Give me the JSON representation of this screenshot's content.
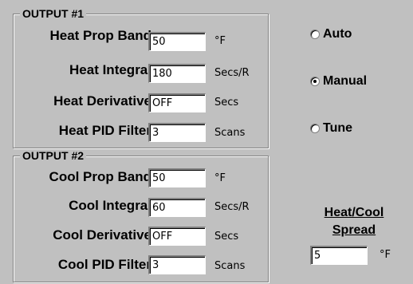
{
  "output1": {
    "title": "OUTPUT #1",
    "fields": [
      {
        "label": "Heat Prop Band",
        "value": "50",
        "unit": "°F"
      },
      {
        "label": "Heat Integral",
        "value": "180",
        "unit": "Secs/R"
      },
      {
        "label": "Heat Derivative",
        "value": "OFF",
        "unit": "Secs"
      },
      {
        "label": "Heat PID Filter",
        "value": "3",
        "unit": "Scans"
      }
    ]
  },
  "output2": {
    "title": "OUTPUT #2",
    "fields": [
      {
        "label": "Cool Prop Band",
        "value": "50",
        "unit": "°F"
      },
      {
        "label": "Cool Integral",
        "value": "60",
        "unit": "Secs/R"
      },
      {
        "label": "Cool Derivative",
        "value": "OFF",
        "unit": "Secs"
      },
      {
        "label": "Cool PID Filter",
        "value": "3",
        "unit": "Scans"
      }
    ]
  },
  "mode": {
    "options": [
      {
        "label": "Auto",
        "selected": false
      },
      {
        "label": "Manual",
        "selected": true
      },
      {
        "label": "Tune",
        "selected": false
      }
    ]
  },
  "spread": {
    "title_line1": "Heat/Cool",
    "title_line2": "Spread",
    "value": "5",
    "unit": "°F"
  }
}
